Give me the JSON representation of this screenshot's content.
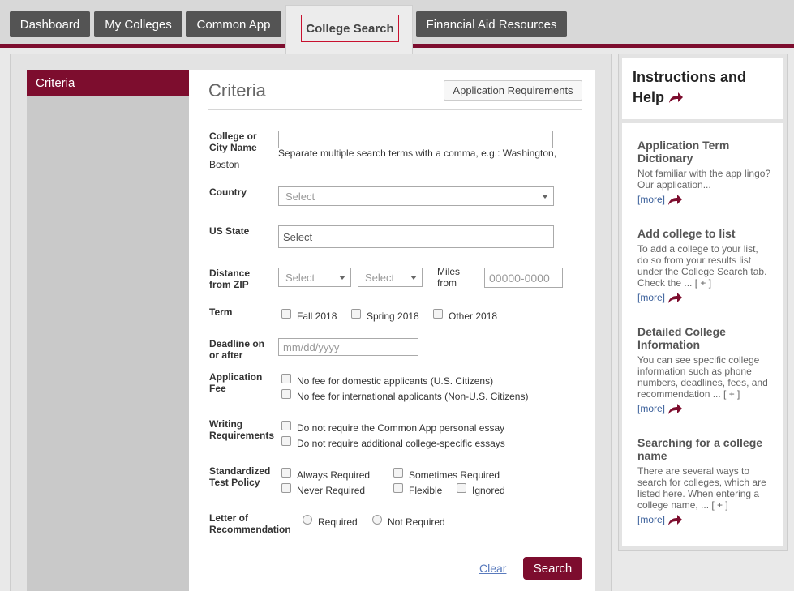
{
  "nav": {
    "tabs": [
      "Dashboard",
      "My Colleges",
      "Common App"
    ],
    "active_tab": "College Search",
    "last_tab": "Financial Aid Resources"
  },
  "sidebar": {
    "criteria_tab": "Criteria"
  },
  "form": {
    "title": "Criteria",
    "app_req_button": "Application Requirements",
    "college_label": "College or City Name",
    "college_hint": "Separate multiple search terms with a comma, e.g.: Washington,",
    "college_hint2": "Boston",
    "college_value": "",
    "country_label": "Country",
    "country_placeholder": "Select",
    "state_label": "US State",
    "state_placeholder": "Select",
    "distance_label": "Distance from ZIP",
    "distance_select1": "Select",
    "distance_select2": "Select",
    "miles_from": "Miles from",
    "zip_placeholder": "00000-0000",
    "term_label": "Term",
    "term_options": [
      "Fall 2018",
      "Spring 2018",
      "Other 2018"
    ],
    "deadline_label": "Deadline on or after",
    "deadline_placeholder": "mm/dd/yyyy",
    "fee_label": "Application Fee",
    "fee_options": [
      "No fee for domestic applicants (U.S. Citizens)",
      "No fee for international applicants (Non-U.S. Citizens)"
    ],
    "writing_label": "Writing Requirements",
    "writing_options": [
      "Do not require the Common App personal essay",
      "Do not require additional college-specific essays"
    ],
    "test_label": "Standardized Test Policy",
    "test_options": [
      "Always Required",
      "Sometimes Required",
      "Never Required",
      "Flexible",
      "Ignored"
    ],
    "rec_label": "Letter of Recommendation",
    "rec_options": [
      "Required",
      "Not Required"
    ],
    "clear_link": "Clear",
    "search_button": "Search"
  },
  "help": {
    "title": "Instructions and Help",
    "items": [
      {
        "title": "Application Term Dictionary",
        "text": "Not familiar with the app lingo? Our application...",
        "more": "[more]"
      },
      {
        "title": "Add college to list",
        "text": "To add a college to your list, do so from your results list under the College Search tab. Check the ... [ + ]",
        "more": "[more]"
      },
      {
        "title": "Detailed College Information",
        "text": "You can see specific college information such as phone numbers, deadlines, fees, and recommendation ... [ + ]",
        "more": "[more]"
      },
      {
        "title": "Searching for a college name",
        "text": "There are several ways to search for colleges, which are listed here. When entering a college name, ... [ + ]",
        "more": "[more]"
      }
    ]
  },
  "colors": {
    "brand": "#7d0d2e",
    "nav_tab": "#545454",
    "link": "#5a7bbd"
  }
}
